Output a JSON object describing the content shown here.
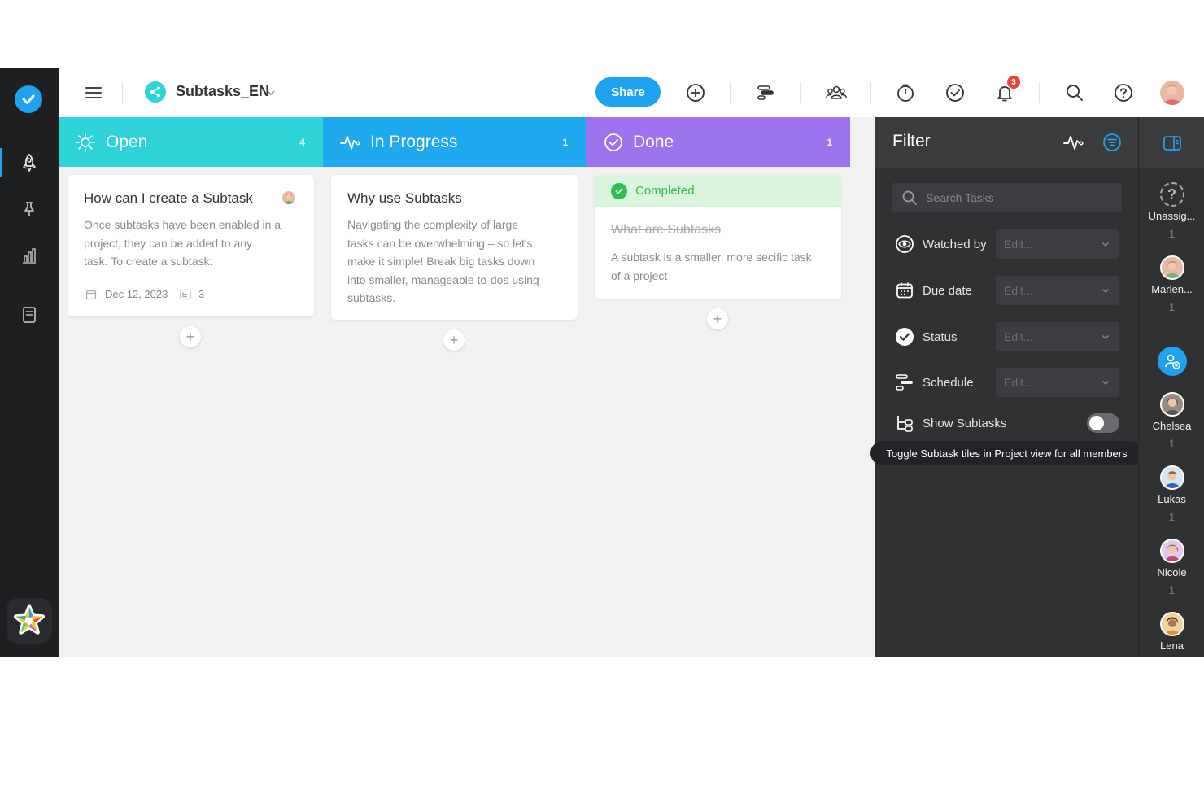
{
  "project": {
    "name": "Subtasks_EN",
    "icon": "share-icon"
  },
  "toolbar": {
    "share_label": "Share",
    "notification_count": "3"
  },
  "columns": [
    {
      "title": "Open",
      "count": "4",
      "color": "#2ed3d9",
      "icon": "sun-icon"
    },
    {
      "title": "In Progress",
      "count": "1",
      "color": "#1fa9ef",
      "icon": "activity-icon"
    },
    {
      "title": "Done",
      "count": "1",
      "color": "#9d73ed",
      "icon": "check-circle-icon"
    }
  ],
  "cards": {
    "open": {
      "title": "How can I create a Subtask",
      "lines": [
        "Once subtasks have been enabled in a",
        "project, they can be added to any",
        "task. To create a subtask:"
      ],
      "date": "Dec 12, 2023",
      "subtask_count": "3"
    },
    "progress": {
      "title": "Why use Subtasks",
      "lines": [
        "Navigating the complexity of large",
        "tasks can be overwhelming – so let's",
        "make it simple! Break big tasks down",
        "into smaller, manageable to-dos using",
        "subtasks."
      ]
    },
    "done": {
      "status": "Completed",
      "title": "What are Subtasks",
      "lines": [
        "A subtask is a smaller, more secific task",
        "of a project"
      ]
    }
  },
  "filter": {
    "title": "Filter",
    "search_placeholder": "Search Tasks",
    "rows": [
      {
        "label": "Watched by",
        "value": "Edit..."
      },
      {
        "label": "Due date",
        "value": "Edit..."
      },
      {
        "label": "Status",
        "value": "Edit..."
      },
      {
        "label": "Schedule",
        "value": "Edit..."
      }
    ],
    "toggle_label": "Show Subtasks",
    "tooltip": "Toggle Subtask tiles in Project view for all members"
  },
  "members": [
    {
      "name": "Unassig...",
      "count": "1"
    },
    {
      "name": "Marlen...",
      "count": "1"
    },
    {
      "name": "Chelsea",
      "count": "1"
    },
    {
      "name": "Lukas",
      "count": "1"
    },
    {
      "name": "Nicole",
      "count": "1"
    },
    {
      "name": "Lena",
      "count": ""
    }
  ]
}
